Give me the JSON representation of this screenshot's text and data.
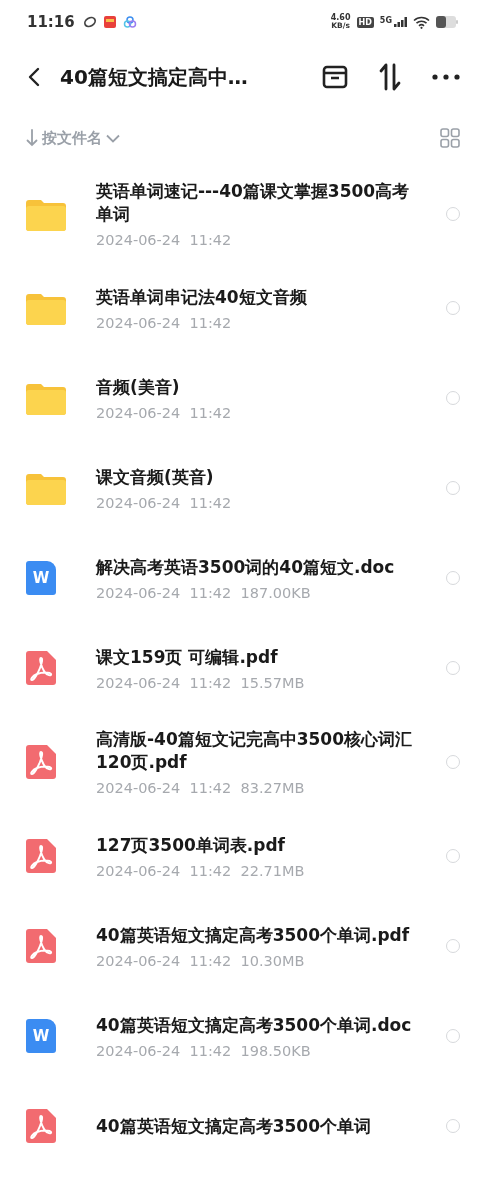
{
  "status_bar": {
    "time": "11:16",
    "speed": "4.60",
    "speed_unit": "KB/s",
    "hd": "HD",
    "network": "5G"
  },
  "header": {
    "title": "40篇短文搞定高中…"
  },
  "sort": {
    "label": "按文件名"
  },
  "files": [
    {
      "kind": "folder",
      "name": "英语单词速记---40篇课文掌握3500高考单词",
      "date": "2024-06-24",
      "time": "11:42",
      "selected": false
    },
    {
      "kind": "folder",
      "name": "英语单词串记法40短文音频",
      "date": "2024-06-24",
      "time": "11:42",
      "selected": false
    },
    {
      "kind": "folder",
      "name": "音频(美音)",
      "date": "2024-06-24",
      "time": "11:42",
      "selected": false
    },
    {
      "kind": "folder",
      "name": "课文音频(英音)",
      "date": "2024-06-24",
      "time": "11:42",
      "selected": false
    },
    {
      "kind": "doc",
      "icon_label": "W",
      "name": "解决高考英语3500词的40篇短文.doc",
      "date": "2024-06-24",
      "time": "11:42",
      "size": "187.00KB",
      "selected": false
    },
    {
      "kind": "pdf",
      "name": "课文159页 可编辑.pdf",
      "date": "2024-06-24",
      "time": "11:42",
      "size": "15.57MB",
      "selected": false
    },
    {
      "kind": "pdf",
      "name": "高清版-40篇短文记完高中3500核心词汇120页.pdf",
      "date": "2024-06-24",
      "time": "11:42",
      "size": "83.27MB",
      "selected": false
    },
    {
      "kind": "pdf",
      "name": "127页3500单词表.pdf",
      "date": "2024-06-24",
      "time": "11:42",
      "size": "22.71MB",
      "selected": false
    },
    {
      "kind": "pdf",
      "name": "40篇英语短文搞定高考3500个单词.pdf",
      "date": "2024-06-24",
      "time": "11:42",
      "size": "10.30MB",
      "selected": false
    },
    {
      "kind": "doc",
      "icon_label": "W",
      "name": "40篇英语短文搞定高考3500个单词.doc",
      "date": "2024-06-24",
      "time": "11:42",
      "size": "198.50KB",
      "selected": false
    },
    {
      "kind": "pdf",
      "name": "40篇英语短文搞定高考3500个单词",
      "selected": false
    }
  ]
}
